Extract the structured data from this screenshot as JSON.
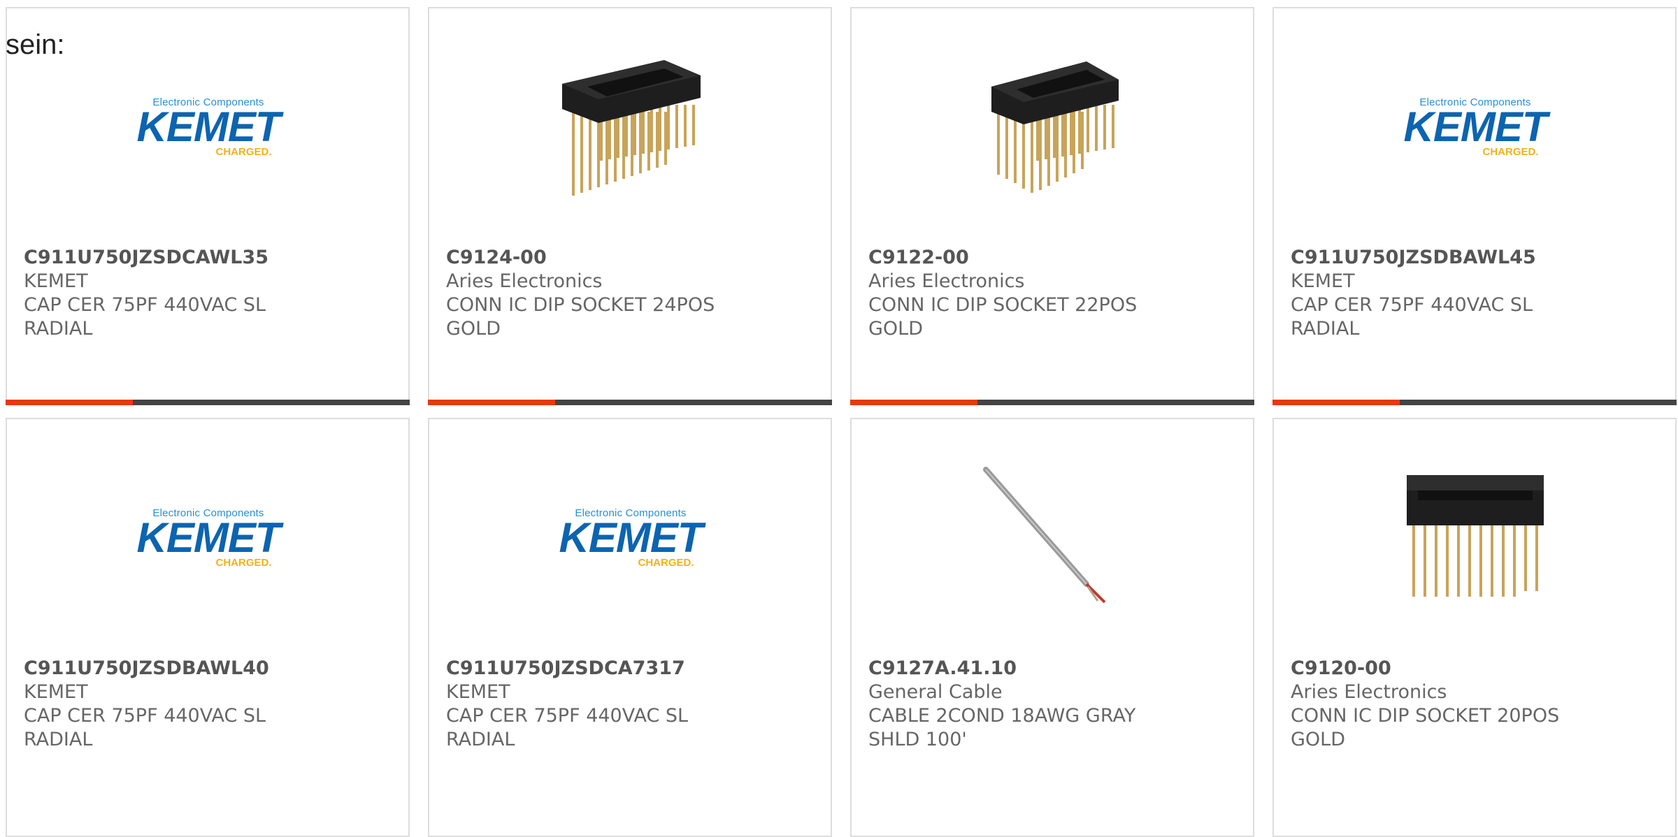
{
  "intro_text": "sein:",
  "logo": {
    "small": "Electronic Components",
    "big": "KEMET",
    "tagline": "CHARGED."
  },
  "colors": {
    "accent": "#e8380d",
    "bar": "#444444",
    "kemet_blue": "#0c64b0",
    "kemet_gold": "#f1b21a"
  },
  "products": [
    {
      "part": "C911U750JZSDCAWL35",
      "manufacturer": "KEMET",
      "desc1": "CAP CER 75PF 440VAC SL",
      "desc2": "RADIAL",
      "image": "kemet-logo"
    },
    {
      "part": "C9124-00",
      "manufacturer": "Aries Electronics",
      "desc1": "CONN IC DIP SOCKET 24POS",
      "desc2": "GOLD",
      "image": "dip-socket-24"
    },
    {
      "part": "C9122-00",
      "manufacturer": "Aries Electronics",
      "desc1": "CONN IC DIP SOCKET 22POS",
      "desc2": "GOLD",
      "image": "dip-socket-22"
    },
    {
      "part": "C911U750JZSDBAWL45",
      "manufacturer": "KEMET",
      "desc1": "CAP CER 75PF 440VAC SL",
      "desc2": "RADIAL",
      "image": "kemet-logo"
    },
    {
      "part": "C911U750JZSDBAWL40",
      "manufacturer": "KEMET",
      "desc1": "CAP CER 75PF 440VAC SL",
      "desc2": "RADIAL",
      "image": "kemet-logo"
    },
    {
      "part": "C911U750JZSDCA7317",
      "manufacturer": "KEMET",
      "desc1": "CAP CER 75PF 440VAC SL",
      "desc2": "RADIAL",
      "image": "kemet-logo"
    },
    {
      "part": "C9127A.41.10",
      "manufacturer": "General Cable",
      "desc1": "CABLE 2COND 18AWG GRAY",
      "desc2": "SHLD 100'",
      "image": "gray-cable"
    },
    {
      "part": "C9120-00",
      "manufacturer": "Aries Electronics",
      "desc1": "CONN IC DIP SOCKET 20POS",
      "desc2": "GOLD",
      "image": "dip-socket-20"
    }
  ]
}
